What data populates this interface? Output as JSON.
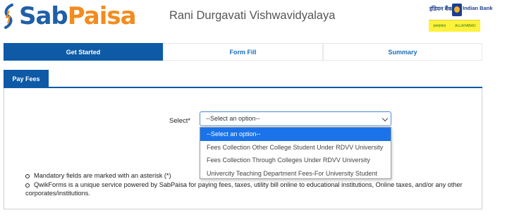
{
  "header": {
    "logo": {
      "part1": "Sab",
      "part2": "Paisa"
    },
    "title": "Rani Durgavati Vishwavidyalaya",
    "bank": {
      "hindi": "इंडियन बैंक",
      "name": "Indian Bank",
      "strip_left": "इलाहाबाद",
      "strip_right": "ALLAHABAD"
    }
  },
  "steps": [
    {
      "label": "Get Started",
      "active": true
    },
    {
      "label": "Form Fill",
      "active": false
    },
    {
      "label": "Summary",
      "active": false
    }
  ],
  "tab": {
    "label": "Pay Fees"
  },
  "form": {
    "select_label": "Select*",
    "selected_value": "--Select an option--",
    "options": [
      "--Select an option--",
      "Fees Collection Other College Student Under RDVV University",
      "Fees Collection Through Colleges Under RDVV University",
      "Univercity Teaching Department Fees-For University Student"
    ]
  },
  "notes": [
    "Mandatory fields are marked with an asterisk (*)",
    "QwikForms is a unique service powered by SabPaisa for paying fees, taxes, utility bill online to educational institutions, Online taxes, and/or any other",
    "corporates/institutions."
  ],
  "colors": {
    "primary": "#0e5aa7",
    "brand_blue": "#1e5fa8",
    "brand_orange": "#f28c1e",
    "highlight": "#1a73e8"
  }
}
